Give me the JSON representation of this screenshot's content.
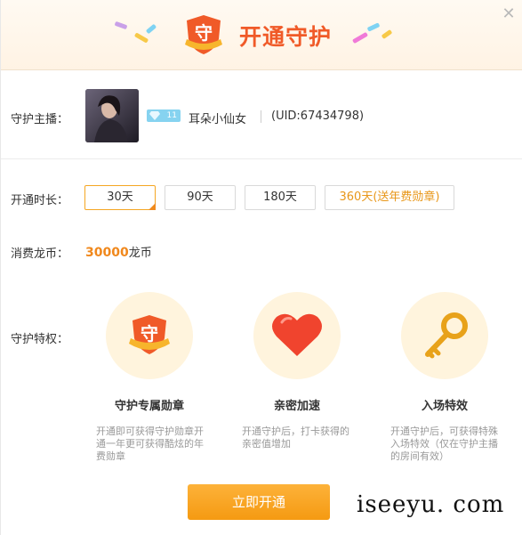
{
  "header": {
    "title": "开通守护",
    "badge_char": "守",
    "close_icon": "close-icon"
  },
  "anchor": {
    "label": "守护主播：",
    "level": "11",
    "name": "耳朵小仙女",
    "uid": "(UID:67434798)"
  },
  "duration": {
    "label": "开通时长：",
    "options": [
      "30天",
      "90天",
      "180天",
      "360天(送年费勋章)"
    ],
    "selected_index": 0
  },
  "cost": {
    "label": "消费龙币：",
    "amount": "30000",
    "unit": "龙币"
  },
  "perks": {
    "label": "守护特权：",
    "items": [
      {
        "icon": "guard-badge-icon",
        "title": "守护专属勋章",
        "desc": "开通即可获得守护勋章开通一年更可获得酷炫的年费勋章"
      },
      {
        "icon": "heart-icon",
        "title": "亲密加速",
        "desc": "开通守护后，打卡获得的亲密值增加"
      },
      {
        "icon": "key-icon",
        "title": "入场特效",
        "desc": "开通守护后，可获得特殊入场特效（仅在守护主播的房间有效）"
      }
    ]
  },
  "cta": {
    "label": "立即开通"
  },
  "watermark": "iseeyu. com",
  "colors": {
    "accent": "#f5a623",
    "title_red": "#f05a28",
    "cost_orange": "#f0881c",
    "badge_blue": "#86d3f0"
  }
}
